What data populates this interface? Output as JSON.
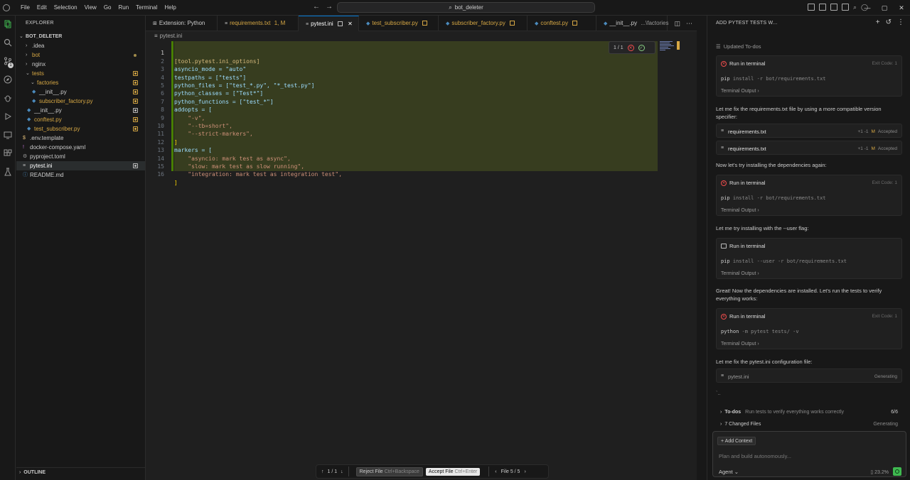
{
  "menu": [
    "File",
    "Edit",
    "Selection",
    "View",
    "Go",
    "Run",
    "Terminal",
    "Help"
  ],
  "command_center": "bot_deleter",
  "explorer": {
    "title": "EXPLORER",
    "root": "BOT_DELETER",
    "items": [
      {
        "label": ".idea",
        "type": "folder"
      },
      {
        "label": "bot",
        "type": "folder"
      },
      {
        "label": "nginx",
        "type": "folder"
      },
      {
        "label": "tests",
        "type": "folder-open"
      },
      {
        "label": "factories",
        "type": "folder-open"
      },
      {
        "label": "__init__.py",
        "type": "py"
      },
      {
        "label": "subscriber_factory.py",
        "type": "py"
      },
      {
        "label": "__init__.py",
        "type": "py"
      },
      {
        "label": "conftest.py",
        "type": "py"
      },
      {
        "label": "test_subscriber.py",
        "type": "py"
      },
      {
        "label": ".env.template",
        "type": "env"
      },
      {
        "label": "docker-compose.yaml",
        "type": "yaml"
      },
      {
        "label": "pyproject.toml",
        "type": "toml"
      },
      {
        "label": "pytest.ini",
        "type": "ini"
      },
      {
        "label": "README.md",
        "type": "md"
      }
    ],
    "outline": "OUTLINE"
  },
  "tabs": [
    {
      "label": "Extension: Python"
    },
    {
      "label": "requirements.txt",
      "suffix": "1, M"
    },
    {
      "label": "pytest.ini"
    },
    {
      "label": "test_subscriber.py"
    },
    {
      "label": "subscriber_factory.py"
    },
    {
      "label": "conftest.py"
    },
    {
      "label": "__init__.py",
      "suffix": "...\\factories"
    }
  ],
  "breadcrumb": "pytest.ini",
  "code_lines": [
    "[tool.pytest.ini_options]",
    "asyncio_mode = \"auto\"",
    "testpaths = [\"tests\"]",
    "python_files = [\"test_*.py\", \"*_test.py\"]",
    "python_classes = [\"Test*\"]",
    "python_functions = [\"test_*\"]",
    "addopts = [",
    "    \"-v\",",
    "    \"--tb=short\",",
    "    \"--strict-markers\",",
    "]",
    "markers = [",
    "    \"asyncio: mark test as async\",",
    "    \"slow: mark test as slow running\",",
    "    \"integration: mark test as integration test\",",
    "]"
  ],
  "diff_widget": {
    "counter": "1 / 1"
  },
  "bottom_bar": {
    "change_counter": "1 / 1",
    "reject_label": "Reject File",
    "reject_shortcut": "Ctrl+Backspace",
    "accept_label": "Accept File",
    "accept_shortcut": "Ctrl+Enter",
    "file_counter": "File 5 / 5"
  },
  "chat": {
    "header": "ADD PYTEST TESTS W...",
    "updated_todos": "Updated To-dos",
    "blocks": [
      {
        "kind": "terminal",
        "title": "Run in terminal",
        "status": "error",
        "exit": "Exit Code: 1",
        "cmd_main": "pip",
        "cmd_rest": " install -r bot/requirements.txt",
        "output": "Terminal Output"
      },
      {
        "kind": "text",
        "text": "Let me fix the requirements.txt file by using a more compatible version specifier:"
      },
      {
        "kind": "file",
        "name": "requirements.txt",
        "stats": "+1 -1",
        "mark": "M",
        "status": "Accepted"
      },
      {
        "kind": "file",
        "name": "requirements.txt",
        "stats": "+1 -1",
        "mark": "M",
        "status": "Accepted"
      },
      {
        "kind": "text",
        "text": "Now let's try installing the dependencies again:"
      },
      {
        "kind": "terminal",
        "title": "Run in terminal",
        "status": "error",
        "exit": "Exit Code: 1",
        "cmd_main": "pip",
        "cmd_rest": " install -r bot/requirements.txt",
        "output": "Terminal Output"
      },
      {
        "kind": "text",
        "text": "Let me try installing with the --user flag:"
      },
      {
        "kind": "terminal",
        "title": "Run in terminal",
        "status": "ok",
        "exit": "",
        "cmd_main": "pip",
        "cmd_rest": " install --user -r bot/requirements.txt",
        "output": "Terminal Output"
      },
      {
        "kind": "text",
        "text": "Great! Now the dependencies are installed. Let's run the tests to verify everything works:"
      },
      {
        "kind": "terminal",
        "title": "Run in terminal",
        "status": "error",
        "exit": "Exit Code: 1",
        "cmd_main": "python",
        "cmd_rest": " -m pytest tests/ -v",
        "output": "Terminal Output"
      },
      {
        "kind": "text",
        "text": "Let me fix the pytest.ini configuration file:"
      },
      {
        "kind": "file",
        "name": "pytest.ini",
        "stats": "",
        "mark": "",
        "status": "Generating"
      }
    ],
    "ellipsis": "`..",
    "todos": {
      "label": "To-dos",
      "sub": "Run tests to verify everything works correctly",
      "count": "6/6"
    },
    "changed": {
      "label": "7 Changed Files",
      "status": "Generating"
    },
    "input": {
      "add_context": "Add Context",
      "placeholder": "Plan and build autonomously...",
      "mode": "Agent",
      "context_pct": "23.2%"
    }
  }
}
